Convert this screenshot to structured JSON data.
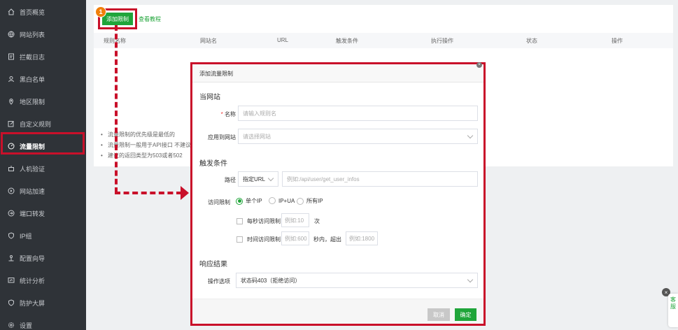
{
  "sidebar": {
    "items": [
      {
        "label": "首页概览",
        "icon": "home-icon"
      },
      {
        "label": "网站列表",
        "icon": "globe-icon"
      },
      {
        "label": "拦截日志",
        "icon": "log-icon"
      },
      {
        "label": "黑白名单",
        "icon": "user-icon"
      },
      {
        "label": "地区限制",
        "icon": "location-icon"
      },
      {
        "label": "自定义规则",
        "icon": "edit-icon"
      },
      {
        "label": "流量限制",
        "icon": "gauge-icon"
      },
      {
        "label": "人机验证",
        "icon": "robot-icon"
      },
      {
        "label": "网站加速",
        "icon": "rocket-icon"
      },
      {
        "label": "端口转发",
        "icon": "forward-icon"
      },
      {
        "label": "IP组",
        "icon": "shield-icon"
      },
      {
        "label": "配置向导",
        "icon": "guide-icon"
      },
      {
        "label": "统计分析",
        "icon": "chart-icon"
      },
      {
        "label": "防护大屏",
        "icon": "screen-icon"
      },
      {
        "label": "设置",
        "icon": "gear-icon"
      }
    ],
    "active_index": 6
  },
  "toolbar": {
    "add_label": "添加限制",
    "tutorial_label": "查看教程",
    "badge": "1"
  },
  "table": {
    "columns": [
      "规则名称",
      "网站名",
      "URL",
      "触发条件",
      "执行操作",
      "状态",
      "操作"
    ]
  },
  "notes": [
    "流量限制的优先级是最低的",
    "流量限制一般用于API接口 不建议",
    "建议的返回类型为503或者502"
  ],
  "modal": {
    "title": "添加流量限制",
    "section_site": "当网站",
    "name_label": "名称",
    "name_required": "*",
    "name_placeholder": "请输入规则名",
    "apply_label": "应用到网站",
    "apply_placeholder": "请选择网站",
    "section_trigger": "触发条件",
    "path_label": "路径",
    "path_select": "指定URL",
    "path_placeholder": "例如:/api/user/get_user_infos",
    "access_label": "访问限制",
    "radio_options": [
      "单个IP",
      "IP+UA",
      "所有IP"
    ],
    "radio_selected": 0,
    "per_second_label": "每秒访问限制",
    "per_second_placeholder": "例如:10",
    "per_second_unit": "次",
    "time_label": "时间访问限制",
    "time_placeholder": "例如:600",
    "time_mid": "秒内，超出",
    "time_limit_placeholder": "例如:1800",
    "section_response": "响应结果",
    "action_label": "操作选项",
    "action_value": "状态码403（拒绝访问）",
    "cancel_label": "取消",
    "confirm_label": "确定"
  },
  "float_widget": {
    "label": "客服",
    "close": "×"
  },
  "colors": {
    "sidebar_bg": "#2f3338",
    "accent": "#20a53a",
    "highlight": "#c9102a",
    "badge": "#f07f0a"
  }
}
